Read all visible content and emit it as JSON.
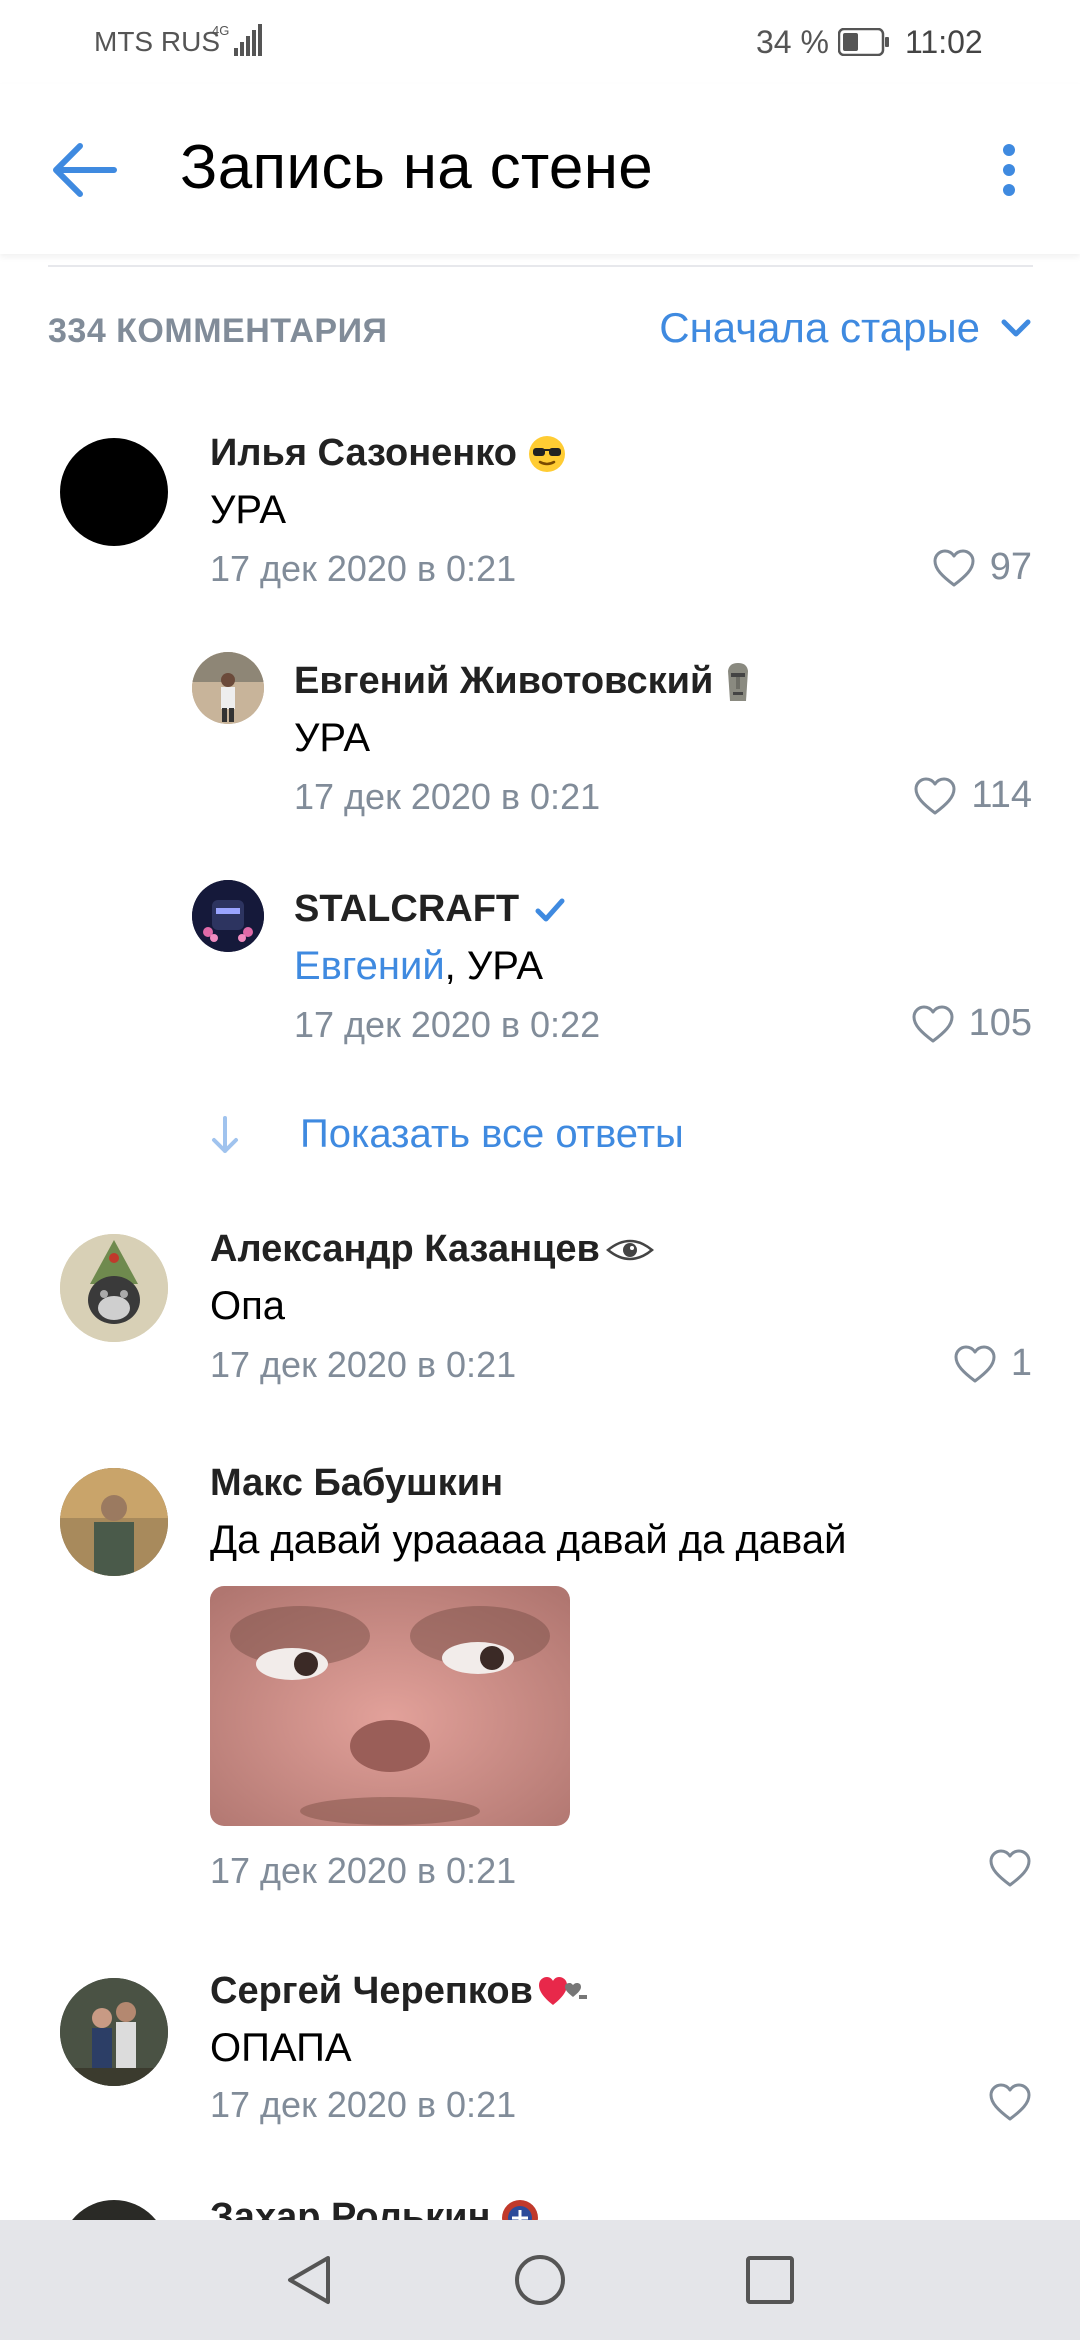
{
  "status_bar": {
    "carrier": "MTS RUS",
    "network": "4G",
    "battery": "34 %",
    "time": "11:02"
  },
  "header": {
    "title": "Запись на стене"
  },
  "comments_header": {
    "count_label": "334 КОММЕНТАРИЯ",
    "sort_label": "Сначала старые"
  },
  "comments": [
    {
      "author": "Илья Сазоненко",
      "text": "УРА",
      "date": "17 дек 2020 в 0:21",
      "likes": "97"
    },
    {
      "author": "Евгений Животовский",
      "text": "УРА",
      "date": "17 дек 2020 в 0:21",
      "likes": "114"
    },
    {
      "author": "STALCRAFT",
      "mention": "Евгений",
      "text": ", УРА",
      "date": "17 дек 2020 в 0:22",
      "likes": "105"
    },
    {
      "author": "Александр Казанцев",
      "text": "Опа",
      "date": "17 дек 2020 в 0:21",
      "likes": "1"
    },
    {
      "author": "Макс Бабушкин",
      "text": "Да давай урааааа давай да давай",
      "date": "17 дек 2020 в 0:21",
      "likes": ""
    },
    {
      "author": "Сергей Черепков",
      "text": "ОПАПА",
      "date": "17 дек 2020 в 0:21",
      "likes": ""
    },
    {
      "author": "Захар Ролькин"
    }
  ],
  "show_replies_label": "Показать все ответы",
  "colors": {
    "accent": "#3f8ae0",
    "secondary": "#818c99",
    "navbar": "#e4e5e9"
  }
}
